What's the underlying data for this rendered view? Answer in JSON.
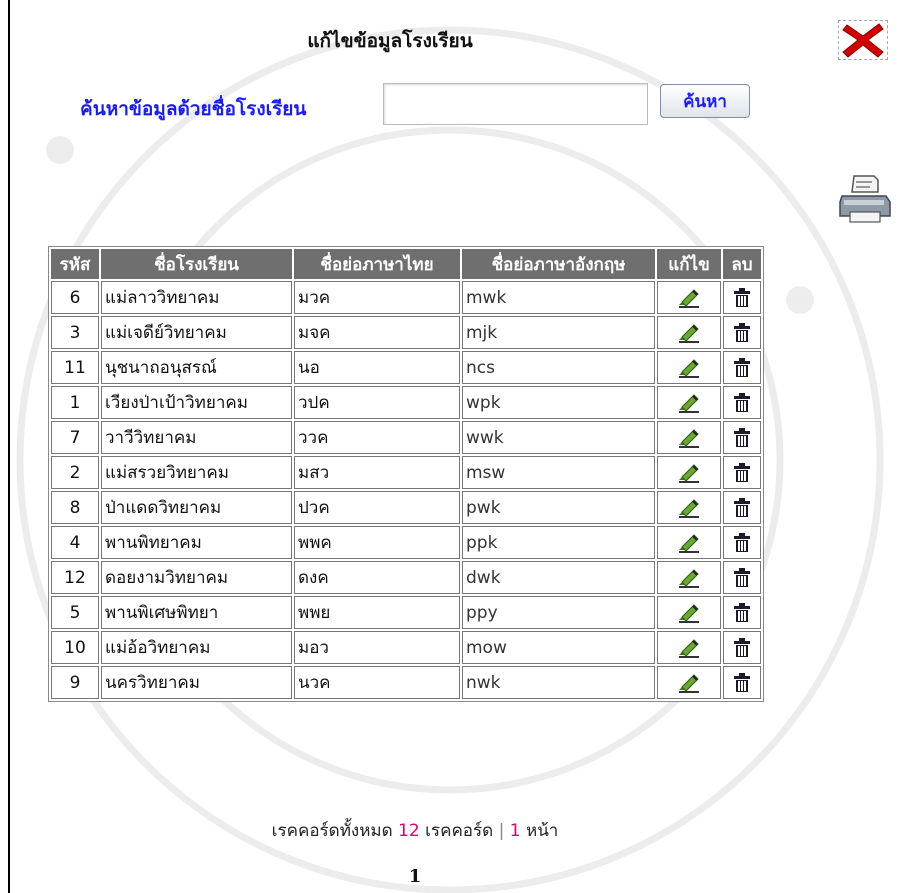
{
  "page": {
    "title": "แก้ไขข้อมูลโรงเรียน",
    "search": {
      "label": "ค้นหาข้อมูลด้วยชื่อโรงเรียน",
      "value": "",
      "placeholder": "",
      "button_label": "ค้นหา"
    }
  },
  "table": {
    "headers": [
      "รหัส",
      "ชื่อโรงเรียน",
      "ชื่อย่อภาษาไทย",
      "ชื่อย่อภาษาอังกฤษ",
      "แก้ไข",
      "ลบ"
    ],
    "rows": [
      {
        "code": "6",
        "name": "แม่ลาววิทยาคม",
        "thai_abbr": "มวค",
        "en_abbr": "mwk"
      },
      {
        "code": "3",
        "name": "แม่เจดีย์วิทยาคม",
        "thai_abbr": "มจค",
        "en_abbr": "mjk"
      },
      {
        "code": "11",
        "name": "นุชนาถอนุสรณ์",
        "thai_abbr": "นอ",
        "en_abbr": "ncs"
      },
      {
        "code": "1",
        "name": "เวียงป่าเป้าวิทยาคม",
        "thai_abbr": "วปค",
        "en_abbr": "wpk"
      },
      {
        "code": "7",
        "name": "วาวีวิทยาคม",
        "thai_abbr": "ววค",
        "en_abbr": "wwk"
      },
      {
        "code": "2",
        "name": "แม่สรวยวิทยาคม",
        "thai_abbr": "มสว",
        "en_abbr": "msw"
      },
      {
        "code": "8",
        "name": "ป่าแดดวิทยาคม",
        "thai_abbr": "ปวค",
        "en_abbr": "pwk"
      },
      {
        "code": "4",
        "name": "พานพิทยาคม",
        "thai_abbr": "พพค",
        "en_abbr": "ppk"
      },
      {
        "code": "12",
        "name": "ดอยงามวิทยาคม",
        "thai_abbr": "ดงค",
        "en_abbr": "dwk"
      },
      {
        "code": "5",
        "name": "พานพิเศษพิทยา",
        "thai_abbr": "พพย",
        "en_abbr": "ppy"
      },
      {
        "code": "10",
        "name": "แม่อ้อวิทยาคม",
        "thai_abbr": "มอว",
        "en_abbr": "mow"
      },
      {
        "code": "9",
        "name": "นครวิทยาคม",
        "thai_abbr": "นวค",
        "en_abbr": "nwk"
      }
    ]
  },
  "summary": {
    "prefix": "เรคคอร์ดทั้งหมด",
    "total": "12",
    "unit": "เรคคอร์ด",
    "separator": "|",
    "pages": "1",
    "pages_unit": "หน้า"
  },
  "pagination": {
    "current": "1"
  },
  "icons": {
    "close": "close-x-icon",
    "print": "printer-icon",
    "edit": "edit-pencil-icon",
    "delete": "trash-icon"
  },
  "colors": {
    "header_bg": "#6f6f6f",
    "link_blue": "#1a1aff",
    "highlight": "#e0006e",
    "close_red": "#d40000"
  }
}
